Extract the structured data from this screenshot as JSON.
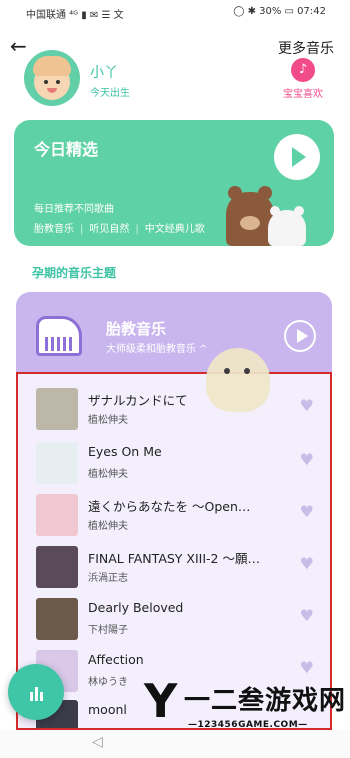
{
  "status": {
    "left": "中国联通 ⁴ᴳ ▮ ✉ ☰ 文",
    "right": "◯ ✱ 30% ▭ 07:42"
  },
  "header": {
    "more_music": "更多音乐",
    "back_icon": "back-arrow-icon"
  },
  "profile": {
    "name": "小丫",
    "birth": "今天出生",
    "likes_label": "宝宝喜欢"
  },
  "daily": {
    "title": "今日精选",
    "desc": "每日推荐不同歌曲",
    "tags": [
      "胎教音乐",
      "听见自然",
      "中文经典儿歌"
    ]
  },
  "section": {
    "title": "孕期的音乐主题"
  },
  "playlist": {
    "title": "胎教音乐",
    "subtitle": "大师级柔和胎教音乐 ^"
  },
  "songs": [
    {
      "title": "ザナルカンドにて",
      "artist": "植松伸夫",
      "thumb_color": "#bdb7aa"
    },
    {
      "title": "Eyes On Me",
      "artist": "植松伸夫",
      "thumb_color": "#e7eef2"
    },
    {
      "title": "遠くからあなたを 〜Open…",
      "artist": "植松伸夫",
      "thumb_color": "#f1c7d2"
    },
    {
      "title": "FINAL FANTASY XIII-2 〜願…",
      "artist": "浜渦正志",
      "thumb_color": "#5b4b5a"
    },
    {
      "title": "Dearly Beloved",
      "artist": "下村陽子",
      "thumb_color": "#6b5a4a"
    },
    {
      "title": "Affection",
      "artist": "林ゆうき",
      "thumb_color": "#d9c8e8"
    },
    {
      "title": "moonl",
      "artist": "",
      "thumb_color": "#3b3b4a"
    }
  ],
  "watermark": {
    "big": "Y",
    "cn": "一二叁游戏网",
    "url": "—123456GAME.COM—"
  },
  "colors": {
    "accent": "#3cc3a4",
    "purple": "#c9b6ee",
    "pink": "#f24b8a"
  }
}
